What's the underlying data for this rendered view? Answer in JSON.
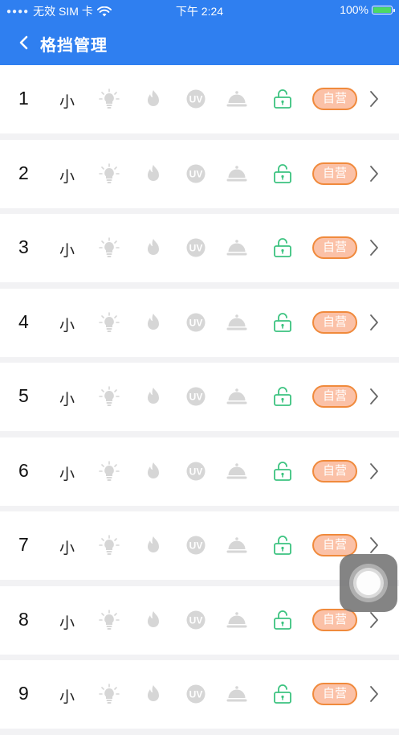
{
  "status_bar": {
    "carrier": "无效 SIM 卡",
    "time": "下午 2:24",
    "battery": "100%"
  },
  "nav": {
    "title": "格挡管理"
  },
  "rows": [
    {
      "num": "1",
      "size": "小",
      "badge": "自营"
    },
    {
      "num": "2",
      "size": "小",
      "badge": "自营"
    },
    {
      "num": "3",
      "size": "小",
      "badge": "自营"
    },
    {
      "num": "4",
      "size": "小",
      "badge": "自营"
    },
    {
      "num": "5",
      "size": "小",
      "badge": "自营"
    },
    {
      "num": "6",
      "size": "小",
      "badge": "自营"
    },
    {
      "num": "7",
      "size": "小",
      "badge": "自营"
    },
    {
      "num": "8",
      "size": "小",
      "badge": "自营"
    },
    {
      "num": "9",
      "size": "小",
      "badge": "自营"
    }
  ],
  "icons": {
    "light": "lightbulb-icon",
    "fire": "flame-icon",
    "uv": "UV",
    "bell": "service-bell-icon",
    "lock": "unlock-icon"
  },
  "colors": {
    "header": "#2f7ff0",
    "icon_inactive": "#d6d6d6",
    "lock_green": "#3cc380",
    "badge_fill": "#fbc1a7",
    "badge_border": "#f08a3c"
  }
}
